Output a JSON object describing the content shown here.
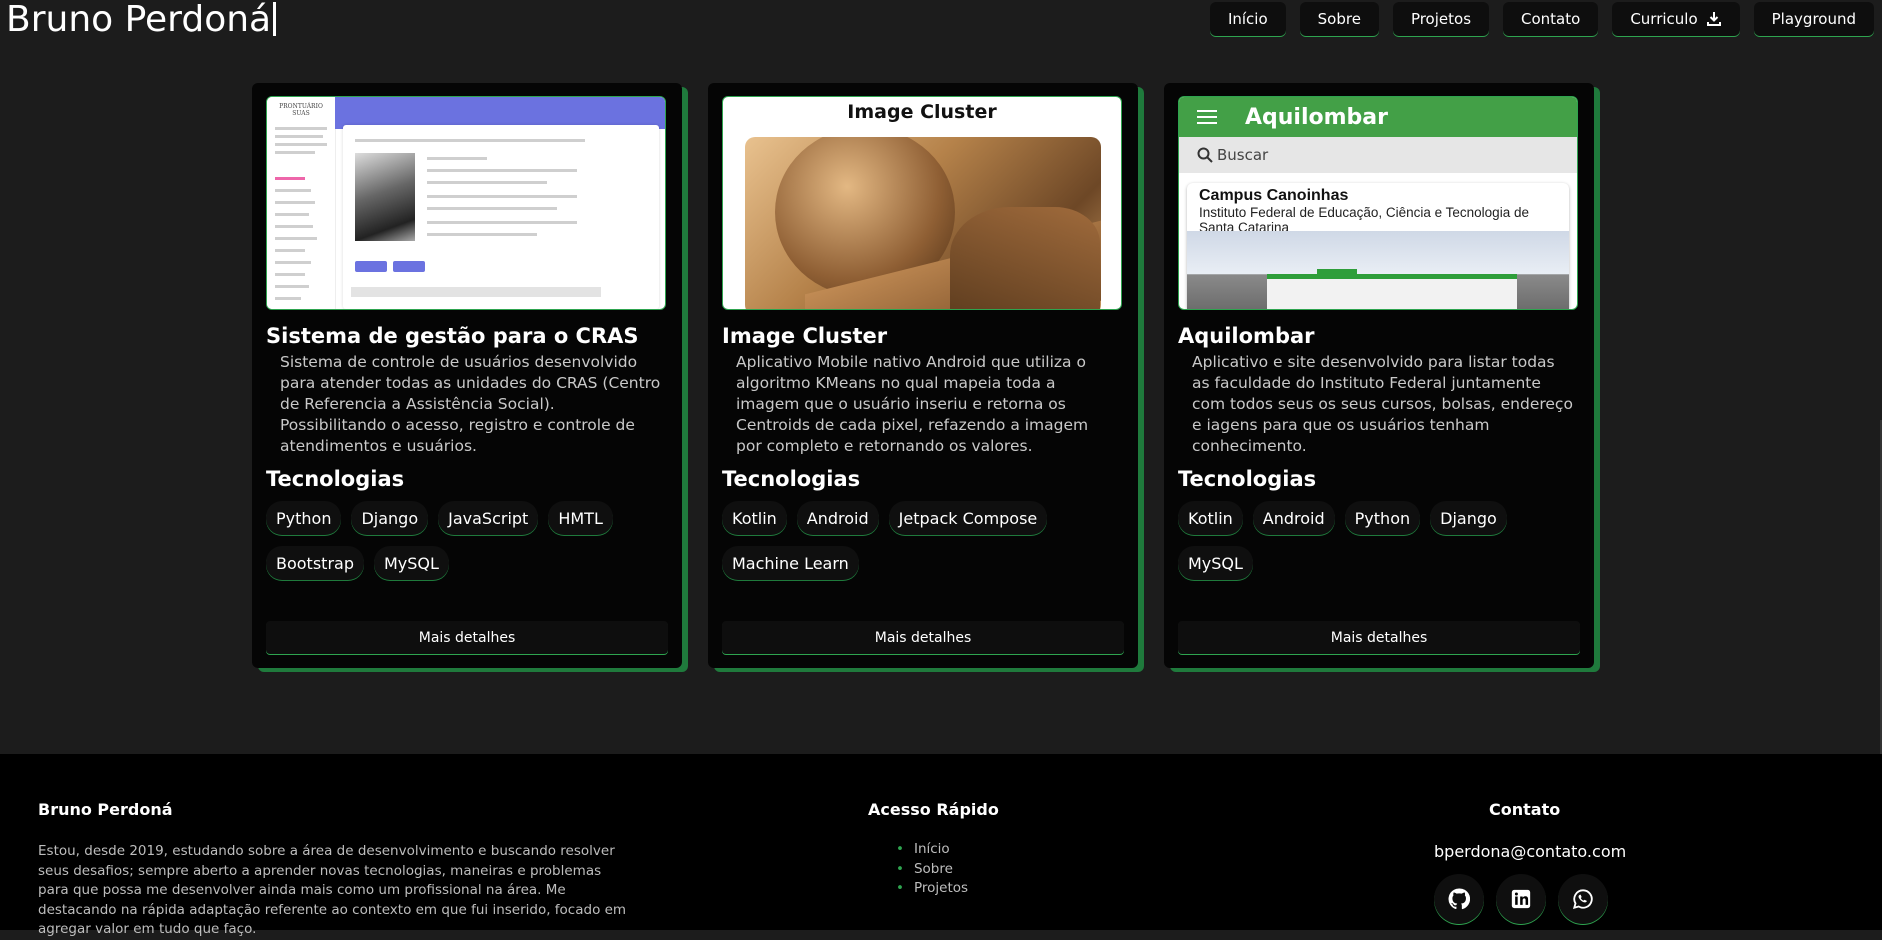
{
  "header": {
    "brand": "Bruno Perdoná",
    "nav": [
      {
        "label": "Início"
      },
      {
        "label": "Sobre"
      },
      {
        "label": "Projetos"
      },
      {
        "label": "Contato"
      },
      {
        "label": "Curriculo",
        "icon": "download-icon"
      },
      {
        "label": "Playground"
      }
    ]
  },
  "projects": [
    {
      "title": "Sistema de gestão para o CRAS",
      "description": "Sistema de controle de usuários desenvolvido para atender todas as unidades do CRAS (Centro de Referencia a Assistência Social). Possibilitando o acesso, registro e controle de atendimentos e usuários.",
      "tech_title": "Tecnologias",
      "techs": [
        "Python",
        "Django",
        "JavaScript",
        "HMTL",
        "Bootstrap",
        "MySQL"
      ],
      "details_label": "Mais detalhes",
      "thumb": {
        "side_title": "PRONTUÁRIO SUAS"
      }
    },
    {
      "title": "Image Cluster",
      "description": "Aplicativo Mobile nativo Android que utiliza o algoritmo KMeans no qual mapeia toda a imagem que o usuário inseriu e retorna os Centroids de cada pixel, refazendo a imagem por completo e retornando os valores.",
      "tech_title": "Tecnologias",
      "techs": [
        "Kotlin",
        "Android",
        "Jetpack Compose",
        "Machine Learn"
      ],
      "details_label": "Mais detalhes",
      "thumb": {
        "header": "Image Cluster"
      }
    },
    {
      "title": "Aquilombar",
      "description": "Aplicativo e site desenvolvido para listar todas as faculdade do Instituto Federal juntamente com todos seus os seus cursos, bolsas, endereço e iagens para que os usuários tenham conhecimento.",
      "tech_title": "Tecnologias",
      "techs": [
        "Kotlin",
        "Android",
        "Python",
        "Django",
        "MySQL"
      ],
      "details_label": "Mais detalhes",
      "thumb": {
        "app_title": "Aquilombar",
        "search_placeholder": "Buscar",
        "campus": "Campus Canoinhas",
        "institute": "Instituto Federal de Educação, Ciência e Tecnologia de Santa Catarina"
      }
    }
  ],
  "footer": {
    "name": "Bruno Perdoná",
    "about": "Estou, desde 2019, estudando sobre a área de desenvolvimento e buscando resolver seus desafios; sempre aberto a aprender novas tecnologias, maneiras e problemas para que possa me desenvolver ainda mais como um profissional na área. Me destacando na rápida adaptação referente ao contexto em que fui inserido, focado em agregar valor em tudo que faço.",
    "quick_title": "Acesso Rápido",
    "quick_links": [
      "Início",
      "Sobre",
      "Projetos"
    ],
    "contact_title": "Contato",
    "email": "bperdona@contato.com",
    "socials": [
      "github-icon",
      "linkedin-icon",
      "whatsapp-icon"
    ]
  },
  "colors": {
    "accent": "#2ea44f",
    "background": "#1c1c1c",
    "card": "#050505"
  }
}
